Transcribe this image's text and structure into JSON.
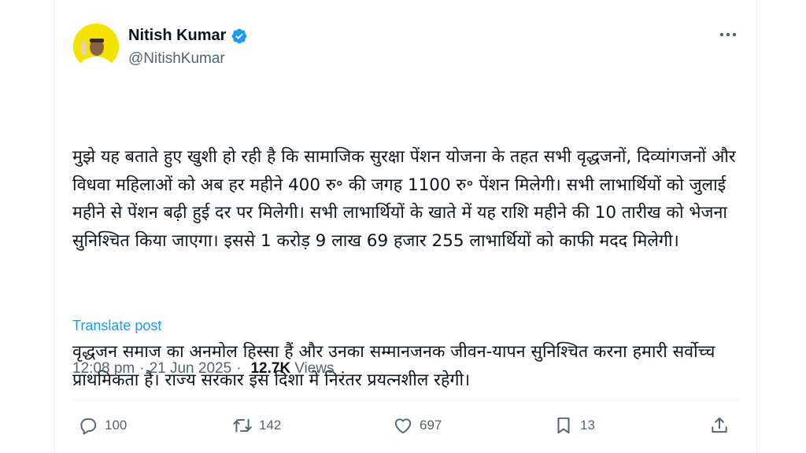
{
  "author": {
    "name": "Nitish Kumar",
    "handle": "@NitishKumar",
    "verified_color": "#1d9bf0"
  },
  "post": {
    "paragraph1": "मुझे यह बताते हुए खुशी हो रही है कि सामाजिक सुरक्षा पेंशन योजना के तहत सभी वृद्धजनों, दिव्यांगजनों और विधवा महिलाओं को अब हर महीने 400 रु॰ की जगह 1100 रु॰ पेंशन मिलेगी। सभी लाभार्थियों को जुलाई महीने से पेंशन बढ़ी हुई दर पर मिलेगी। सभी लाभार्थियों के खाते में यह राशि महीने की 10 तारीख को भेजना सुनिश्चित किया जाएगा। इससे 1 करोड़ 9 लाख 69 हजार 255 लाभार्थियों को काफी मदद मिलेगी।",
    "paragraph2": "वृद्धजन समाज का अनमोल हिस्सा हैं और उनका सम्मानजनक जीवन-यापन सुनिश्चित करना हमारी सर्वोच्च प्राथमिकता है। राज्य सरकार इस दिशा में निरंतर प्रयत्नशील रहेगी।",
    "translate_label": "Translate post",
    "time": "12:08 pm",
    "separator": "·",
    "date": "21 Jun 2025",
    "views_count": "12.7K",
    "views_label": "Views"
  },
  "actions": {
    "replies": "100",
    "reposts": "142",
    "likes": "697",
    "bookmarks": "13"
  },
  "colors": {
    "text": "#0f1419",
    "muted": "#536471",
    "link": "#1d9bf0"
  }
}
